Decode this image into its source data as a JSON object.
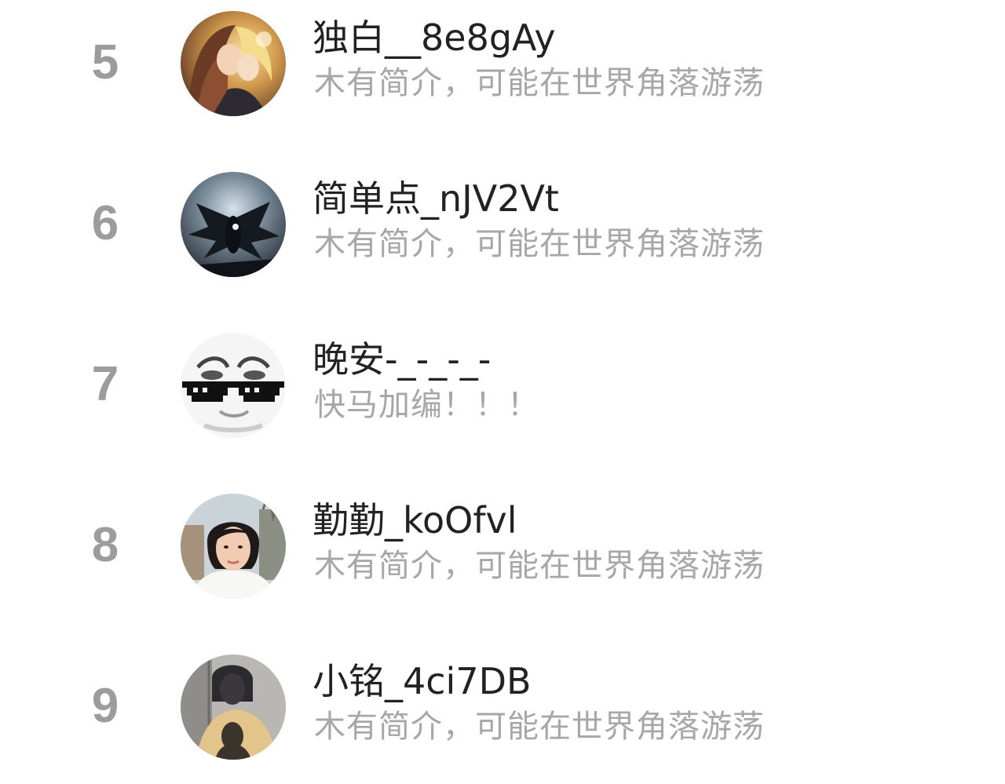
{
  "ranking": {
    "items": [
      {
        "rank": "5",
        "name": "独白__8e8gAy",
        "bio": "木有简介，可能在世界角落游荡",
        "avatar": "anime-couple-avatar"
      },
      {
        "rank": "6",
        "name": "简单点_nJV2Vt",
        "bio": "木有简介，可能在世界角落游荡",
        "avatar": "dark-winged-figure-avatar"
      },
      {
        "rank": "7",
        "name": "晚安-_-_-_-",
        "bio": "快马加编！！！",
        "avatar": "meme-sunglasses-face-avatar"
      },
      {
        "rank": "8",
        "name": "勤勤_koOfvl",
        "bio": "木有简介，可能在世界角落游荡",
        "avatar": "woman-selfie-avatar"
      },
      {
        "rank": "9",
        "name": "小铭_4ci7DB",
        "bio": "木有简介，可能在世界角落游荡",
        "avatar": "shadow-portrait-avatar"
      }
    ]
  }
}
